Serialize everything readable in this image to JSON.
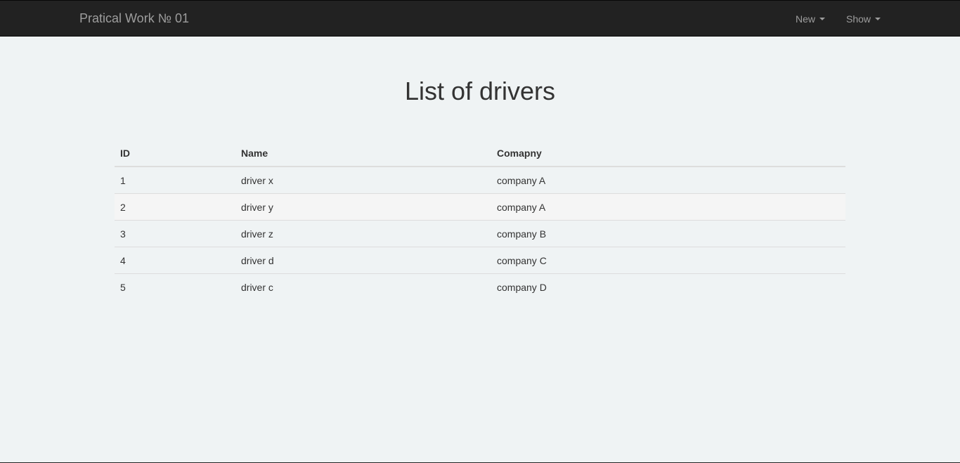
{
  "navbar": {
    "brand": "Pratical Work № 01",
    "menu": [
      {
        "label": "New"
      },
      {
        "label": "Show"
      }
    ]
  },
  "main": {
    "title": "List of drivers",
    "table": {
      "headers": [
        "ID",
        "Name",
        "Comapny"
      ],
      "rows": [
        {
          "id": "1",
          "name": "driver x",
          "company": "company A"
        },
        {
          "id": "2",
          "name": "driver y",
          "company": "company A"
        },
        {
          "id": "3",
          "name": "driver z",
          "company": "company B"
        },
        {
          "id": "4",
          "name": "driver d",
          "company": "company C"
        },
        {
          "id": "5",
          "name": "driver c",
          "company": "company D"
        }
      ]
    }
  },
  "colors": {
    "navbar_bg": "#222222",
    "navbar_text": "#9d9d9d",
    "page_bg": "#eff3f4",
    "striped_row": "#f5f5f5"
  },
  "icons": {
    "dropdown": "caret-down-icon"
  }
}
